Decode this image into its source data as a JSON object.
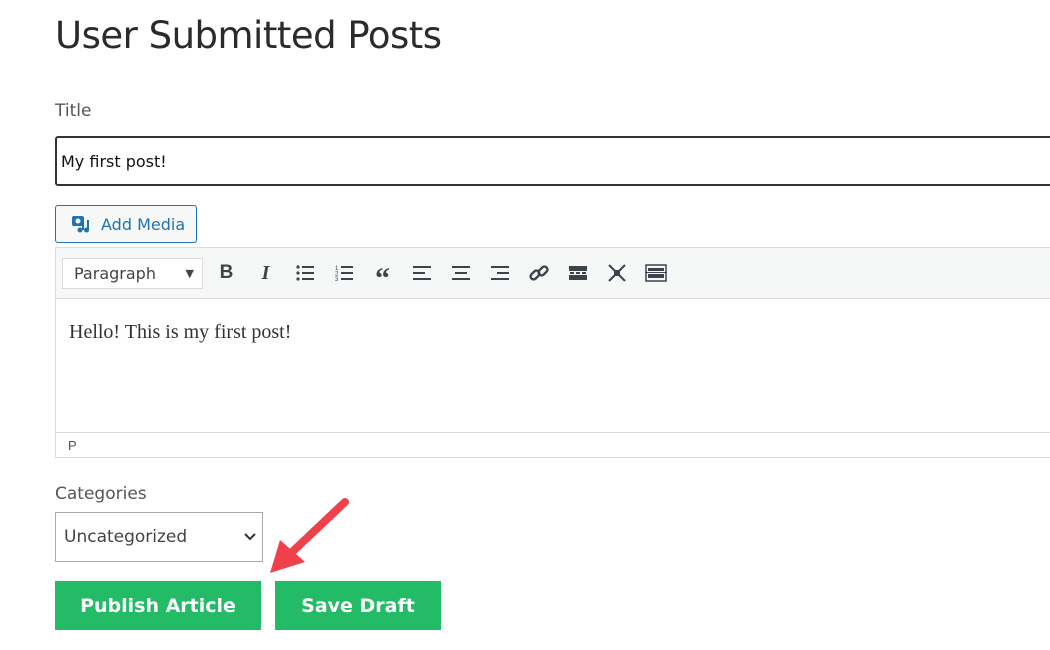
{
  "page": {
    "title": "User Submitted Posts"
  },
  "form": {
    "title_label": "Title",
    "title_value": "My first post!",
    "add_media_label": "Add Media",
    "editor": {
      "format_select": "Paragraph",
      "toolbar_icons": [
        "bold-icon",
        "italic-icon",
        "bulleted-list-icon",
        "numbered-list-icon",
        "blockquote-icon",
        "align-left-icon",
        "align-center-icon",
        "align-right-icon",
        "link-icon",
        "read-more-icon",
        "fullscreen-icon",
        "toolbar-toggle-icon"
      ],
      "content": "Hello! This is my first post!",
      "status_path": "P"
    },
    "categories_label": "Categories",
    "categories_value": "Uncategorized",
    "publish_label": "Publish Article",
    "draft_label": "Save Draft"
  },
  "colors": {
    "button": "#23bb65",
    "accent": "#2271b1",
    "arrow": "#f0414b"
  }
}
